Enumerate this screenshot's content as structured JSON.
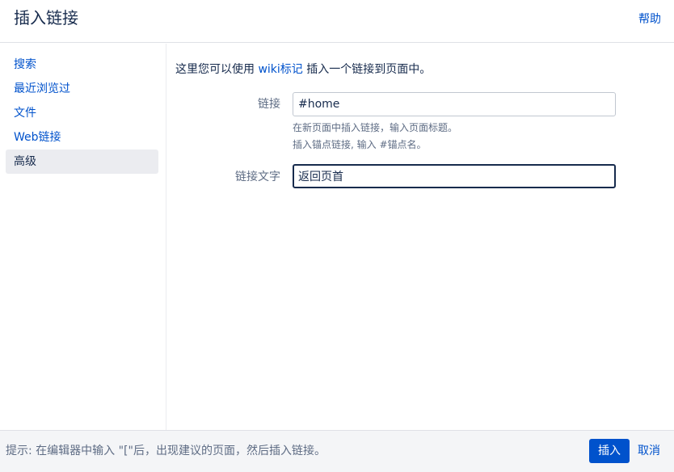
{
  "header": {
    "title": "插入链接",
    "help_label": "帮助"
  },
  "sidebar": {
    "items": [
      {
        "label": "搜索",
        "active": false
      },
      {
        "label": "最近浏览过",
        "active": false
      },
      {
        "label": "文件",
        "active": false
      },
      {
        "label": "Web链接",
        "active": false
      },
      {
        "label": "高级",
        "active": true
      }
    ]
  },
  "main": {
    "intro_prefix": "这里您可以使用 ",
    "intro_link": "wiki标记",
    "intro_suffix": " 插入一个链接到页面中。",
    "link_field": {
      "label": "链接",
      "value": "#home",
      "hint_line1": "在新页面中插入链接，输入页面标题。",
      "hint_line2": "插入锚点链接, 输入 #锚点名。"
    },
    "text_field": {
      "label": "链接文字",
      "value": "返回页首"
    }
  },
  "footer": {
    "tip": "提示: 在编辑器中输入 \"[\"后，出现建议的页面，然后插入链接。",
    "insert_label": "插入",
    "cancel_label": "取消"
  },
  "colors": {
    "accent": "#0052cc",
    "text": "#172b4d",
    "muted": "#5e6c84",
    "nav_active_bg": "#ebecf0"
  }
}
